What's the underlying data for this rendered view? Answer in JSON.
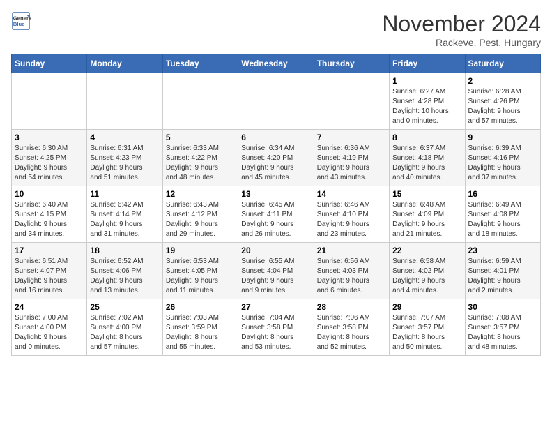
{
  "header": {
    "logo_line1": "General",
    "logo_line2": "Blue",
    "title": "November 2024",
    "subtitle": "Rackeve, Pest, Hungary"
  },
  "days_of_week": [
    "Sunday",
    "Monday",
    "Tuesday",
    "Wednesday",
    "Thursday",
    "Friday",
    "Saturday"
  ],
  "weeks": [
    [
      {
        "day": "",
        "info": ""
      },
      {
        "day": "",
        "info": ""
      },
      {
        "day": "",
        "info": ""
      },
      {
        "day": "",
        "info": ""
      },
      {
        "day": "",
        "info": ""
      },
      {
        "day": "1",
        "info": "Sunrise: 6:27 AM\nSunset: 4:28 PM\nDaylight: 10 hours\nand 0 minutes."
      },
      {
        "day": "2",
        "info": "Sunrise: 6:28 AM\nSunset: 4:26 PM\nDaylight: 9 hours\nand 57 minutes."
      }
    ],
    [
      {
        "day": "3",
        "info": "Sunrise: 6:30 AM\nSunset: 4:25 PM\nDaylight: 9 hours\nand 54 minutes."
      },
      {
        "day": "4",
        "info": "Sunrise: 6:31 AM\nSunset: 4:23 PM\nDaylight: 9 hours\nand 51 minutes."
      },
      {
        "day": "5",
        "info": "Sunrise: 6:33 AM\nSunset: 4:22 PM\nDaylight: 9 hours\nand 48 minutes."
      },
      {
        "day": "6",
        "info": "Sunrise: 6:34 AM\nSunset: 4:20 PM\nDaylight: 9 hours\nand 45 minutes."
      },
      {
        "day": "7",
        "info": "Sunrise: 6:36 AM\nSunset: 4:19 PM\nDaylight: 9 hours\nand 43 minutes."
      },
      {
        "day": "8",
        "info": "Sunrise: 6:37 AM\nSunset: 4:18 PM\nDaylight: 9 hours\nand 40 minutes."
      },
      {
        "day": "9",
        "info": "Sunrise: 6:39 AM\nSunset: 4:16 PM\nDaylight: 9 hours\nand 37 minutes."
      }
    ],
    [
      {
        "day": "10",
        "info": "Sunrise: 6:40 AM\nSunset: 4:15 PM\nDaylight: 9 hours\nand 34 minutes."
      },
      {
        "day": "11",
        "info": "Sunrise: 6:42 AM\nSunset: 4:14 PM\nDaylight: 9 hours\nand 31 minutes."
      },
      {
        "day": "12",
        "info": "Sunrise: 6:43 AM\nSunset: 4:12 PM\nDaylight: 9 hours\nand 29 minutes."
      },
      {
        "day": "13",
        "info": "Sunrise: 6:45 AM\nSunset: 4:11 PM\nDaylight: 9 hours\nand 26 minutes."
      },
      {
        "day": "14",
        "info": "Sunrise: 6:46 AM\nSunset: 4:10 PM\nDaylight: 9 hours\nand 23 minutes."
      },
      {
        "day": "15",
        "info": "Sunrise: 6:48 AM\nSunset: 4:09 PM\nDaylight: 9 hours\nand 21 minutes."
      },
      {
        "day": "16",
        "info": "Sunrise: 6:49 AM\nSunset: 4:08 PM\nDaylight: 9 hours\nand 18 minutes."
      }
    ],
    [
      {
        "day": "17",
        "info": "Sunrise: 6:51 AM\nSunset: 4:07 PM\nDaylight: 9 hours\nand 16 minutes."
      },
      {
        "day": "18",
        "info": "Sunrise: 6:52 AM\nSunset: 4:06 PM\nDaylight: 9 hours\nand 13 minutes."
      },
      {
        "day": "19",
        "info": "Sunrise: 6:53 AM\nSunset: 4:05 PM\nDaylight: 9 hours\nand 11 minutes."
      },
      {
        "day": "20",
        "info": "Sunrise: 6:55 AM\nSunset: 4:04 PM\nDaylight: 9 hours\nand 9 minutes."
      },
      {
        "day": "21",
        "info": "Sunrise: 6:56 AM\nSunset: 4:03 PM\nDaylight: 9 hours\nand 6 minutes."
      },
      {
        "day": "22",
        "info": "Sunrise: 6:58 AM\nSunset: 4:02 PM\nDaylight: 9 hours\nand 4 minutes."
      },
      {
        "day": "23",
        "info": "Sunrise: 6:59 AM\nSunset: 4:01 PM\nDaylight: 9 hours\nand 2 minutes."
      }
    ],
    [
      {
        "day": "24",
        "info": "Sunrise: 7:00 AM\nSunset: 4:00 PM\nDaylight: 9 hours\nand 0 minutes."
      },
      {
        "day": "25",
        "info": "Sunrise: 7:02 AM\nSunset: 4:00 PM\nDaylight: 8 hours\nand 57 minutes."
      },
      {
        "day": "26",
        "info": "Sunrise: 7:03 AM\nSunset: 3:59 PM\nDaylight: 8 hours\nand 55 minutes."
      },
      {
        "day": "27",
        "info": "Sunrise: 7:04 AM\nSunset: 3:58 PM\nDaylight: 8 hours\nand 53 minutes."
      },
      {
        "day": "28",
        "info": "Sunrise: 7:06 AM\nSunset: 3:58 PM\nDaylight: 8 hours\nand 52 minutes."
      },
      {
        "day": "29",
        "info": "Sunrise: 7:07 AM\nSunset: 3:57 PM\nDaylight: 8 hours\nand 50 minutes."
      },
      {
        "day": "30",
        "info": "Sunrise: 7:08 AM\nSunset: 3:57 PM\nDaylight: 8 hours\nand 48 minutes."
      }
    ]
  ]
}
